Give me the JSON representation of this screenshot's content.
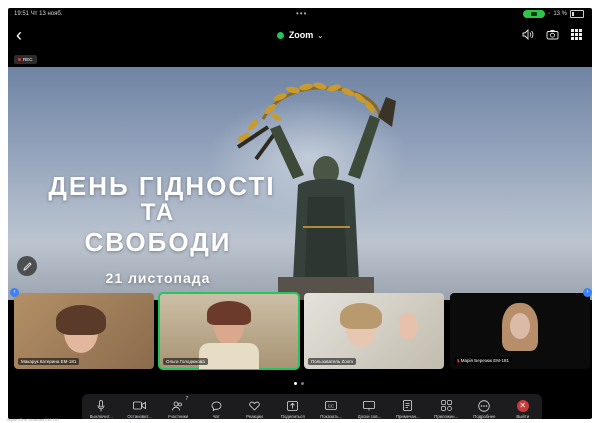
{
  "status_bar": {
    "time": "19:51",
    "date": "Чт 13 нояб.",
    "battery": "13 %"
  },
  "header": {
    "back_glyph": "‹",
    "title": "Zoom",
    "dropdown_glyph": "⌄"
  },
  "recording_badge": "REC",
  "slide": {
    "line1": "ДЕНЬ ГІДНОСТІ",
    "line2": "ТА",
    "line3": "СВОБОДИ",
    "date": "21 листопада"
  },
  "participants": [
    {
      "name": "Макарук Катерина ЕМ-181"
    },
    {
      "name": "Ольга Голодюкова"
    },
    {
      "name": "Пользователь Zoom"
    },
    {
      "name": "Марія Березюк ЕМ-181"
    }
  ],
  "toolbar": {
    "items": [
      {
        "label": "Выключит...",
        "icon": "mic-icon"
      },
      {
        "label": "Остановит...",
        "icon": "video-camera-icon"
      },
      {
        "label": "Участники",
        "icon": "participants-icon",
        "count": "7"
      },
      {
        "label": "Чат",
        "icon": "chat-icon"
      },
      {
        "label": "Реакции",
        "icon": "heart-icon"
      },
      {
        "label": "Поделиться",
        "icon": "share-arrow-icon"
      },
      {
        "label": "Показать...",
        "icon": "captions-icon"
      },
      {
        "label": "Доски сов...",
        "icon": "whiteboard-icon"
      },
      {
        "label": "Примечан...",
        "icon": "notes-icon"
      },
      {
        "label": "Приложен...",
        "icon": "apps-icon"
      },
      {
        "label": "Подробнее",
        "icon": "more-icon"
      },
      {
        "label": "Выйти",
        "icon": "leave-icon"
      }
    ]
  },
  "footer_text": "Экран Юля Ушакова ЕМ-181",
  "colors": {
    "active_speaker": "#22c55e",
    "leave": "#c93a3a",
    "zoom_dot": "#22c55e"
  }
}
